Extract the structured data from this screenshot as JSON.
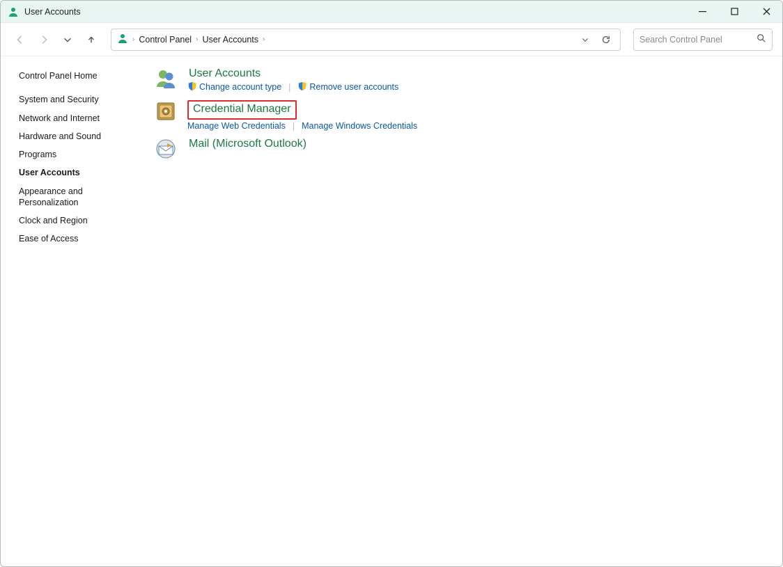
{
  "window": {
    "title": "User Accounts"
  },
  "breadcrumb": {
    "root": "Control Panel",
    "current": "User Accounts"
  },
  "search": {
    "placeholder": "Search Control Panel"
  },
  "sidebar": {
    "items": [
      {
        "label": "Control Panel Home"
      },
      {
        "label": "System and Security"
      },
      {
        "label": "Network and Internet"
      },
      {
        "label": "Hardware and Sound"
      },
      {
        "label": "Programs"
      },
      {
        "label": "User Accounts"
      },
      {
        "label": "Appearance and Personalization"
      },
      {
        "label": "Clock and Region"
      },
      {
        "label": "Ease of Access"
      }
    ],
    "active_index": 5
  },
  "categories": [
    {
      "title": "User Accounts",
      "highlighted": false,
      "links": [
        {
          "label": "Change account type",
          "shield": true
        },
        {
          "label": "Remove user accounts",
          "shield": true
        }
      ]
    },
    {
      "title": "Credential Manager",
      "highlighted": true,
      "links": [
        {
          "label": "Manage Web Credentials",
          "shield": false
        },
        {
          "label": "Manage Windows Credentials",
          "shield": false
        }
      ]
    },
    {
      "title": "Mail (Microsoft Outlook)",
      "highlighted": false,
      "links": []
    }
  ]
}
